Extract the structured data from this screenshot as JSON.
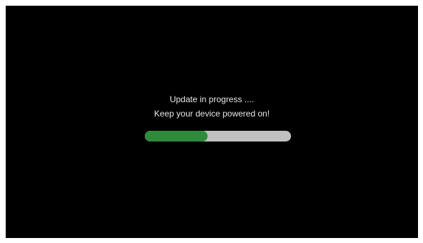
{
  "message": {
    "line1": "Update in progress ....",
    "line2": "Keep your device powered on!"
  },
  "progress": {
    "fraction": 0.43
  },
  "colors": {
    "background": "#000000",
    "text": "#e8e8e8",
    "progress_fill": "#2e8b3a",
    "progress_track": "#c0c0c0"
  }
}
